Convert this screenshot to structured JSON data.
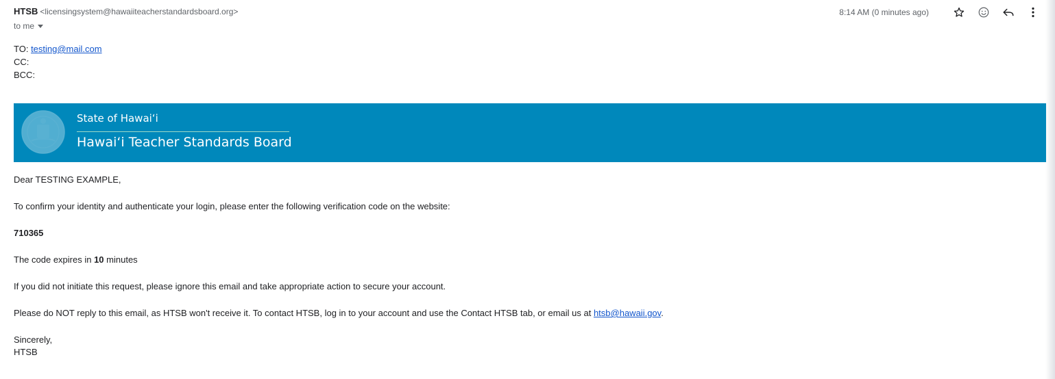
{
  "message": {
    "sender_name": "HTSB",
    "sender_email": "<licensingsystem@hawaiiteacherstandardsboard.org>",
    "to_label": "to me",
    "time": "8:14 AM (0 minutes ago)"
  },
  "actions": {
    "star_icon": "star-icon",
    "emoji_icon": "emoji-icon",
    "reply_icon": "reply-icon",
    "more_icon": "more-vert-icon"
  },
  "recipients": {
    "to_label": "TO:",
    "to_email": "testing@mail.com",
    "cc_label": "CC:",
    "bcc_label": "BCC:"
  },
  "banner": {
    "subtitle": "State of Hawaiʻi",
    "title": "Hawaiʻi Teacher Standards Board",
    "color": "#0088bb"
  },
  "body": {
    "greeting": "Dear TESTING EXAMPLE,",
    "intro": "To confirm your identity and authenticate your login, please enter the following verification code on the website:",
    "code": "710365",
    "expires_pre": "The code expires in ",
    "expires_num": "10",
    "expires_post": " minutes",
    "ignore": "If you did not initiate this request, please ignore this email and take appropriate action to secure your account.",
    "noreply": "Please do NOT reply to this email, as HTSB won't receive it. To contact HTSB, log in to your account and use the Contact HTSB tab, or email us at ",
    "contact_email": "htsb@hawaii.gov",
    "noreply_end": ".",
    "closing": "Sincerely,",
    "signature": "HTSB"
  }
}
